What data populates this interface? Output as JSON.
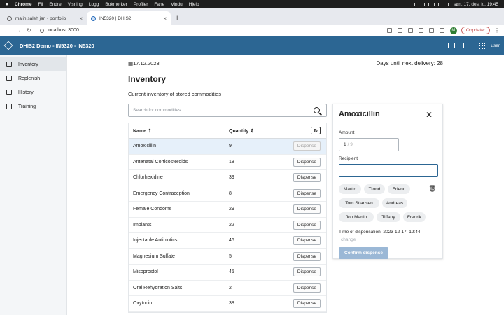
{
  "menubar": {
    "app_name": "Chrome",
    "menus": [
      "Fil",
      "Endre",
      "Visning",
      "Logg",
      "Bokmerker",
      "Profiler",
      "Fane",
      "Vindu",
      "Hjelp"
    ],
    "clock": "søn. 17. des. kl. 19:45"
  },
  "browser": {
    "tabs": [
      {
        "label": "malin saleh jan - portfolio"
      },
      {
        "label": "IN5320 | DHIS2"
      }
    ],
    "url": "localhost:3000",
    "profile_initial": "M",
    "update_label": "Oppdater"
  },
  "header": {
    "title": "DHIS2 Demo - IN5320 - IN5320",
    "user_label": "user"
  },
  "sidebar": {
    "items": [
      {
        "label": "Inventory",
        "icon": "inventory-icon",
        "active": true
      },
      {
        "label": "Replenish",
        "icon": "replenish-icon",
        "active": false
      },
      {
        "label": "History",
        "icon": "history-icon",
        "active": false
      },
      {
        "label": "Training",
        "icon": "training-icon",
        "active": false
      }
    ]
  },
  "page": {
    "date": "17.12.2023",
    "days_until_delivery": "Days until next delivery: 28",
    "title": "Inventory",
    "subtitle": "Current inventory of stored commodities",
    "search_placeholder": "Search for commodities"
  },
  "table": {
    "headers": {
      "name": "Name",
      "quantity": "Quantity"
    },
    "dispense_label": "Dispense",
    "rows": [
      {
        "name": "Amoxicillin",
        "quantity": "9",
        "selected": true
      },
      {
        "name": "Antenatal Corticosteroids",
        "quantity": "18"
      },
      {
        "name": "Chlorhexidine",
        "quantity": "39"
      },
      {
        "name": "Emergency Contraception",
        "quantity": "8"
      },
      {
        "name": "Female Condoms",
        "quantity": "29"
      },
      {
        "name": "Implants",
        "quantity": "22"
      },
      {
        "name": "Injectable Antibiotics",
        "quantity": "46"
      },
      {
        "name": "Magnesium Sulfate",
        "quantity": "5"
      },
      {
        "name": "Misoprostol",
        "quantity": "45"
      },
      {
        "name": "Oral Rehydration Salts",
        "quantity": "2"
      },
      {
        "name": "Oxytocin",
        "quantity": "38"
      }
    ]
  },
  "panel": {
    "title": "Amoxicillin",
    "amount_label": "Amount",
    "amount_value": "1",
    "amount_max": "/ 9",
    "recipient_label": "Recipient",
    "recipients": [
      "Martin",
      "Trond",
      "Erlend",
      "Tom Stiansen",
      "Andreas",
      "Jon Martin",
      "Tiffany",
      "Fredrik"
    ],
    "time_text": "Time of dispensation: 2023-12-17, 19:44",
    "change_label": "change",
    "confirm_label": "Confirm dispense"
  }
}
